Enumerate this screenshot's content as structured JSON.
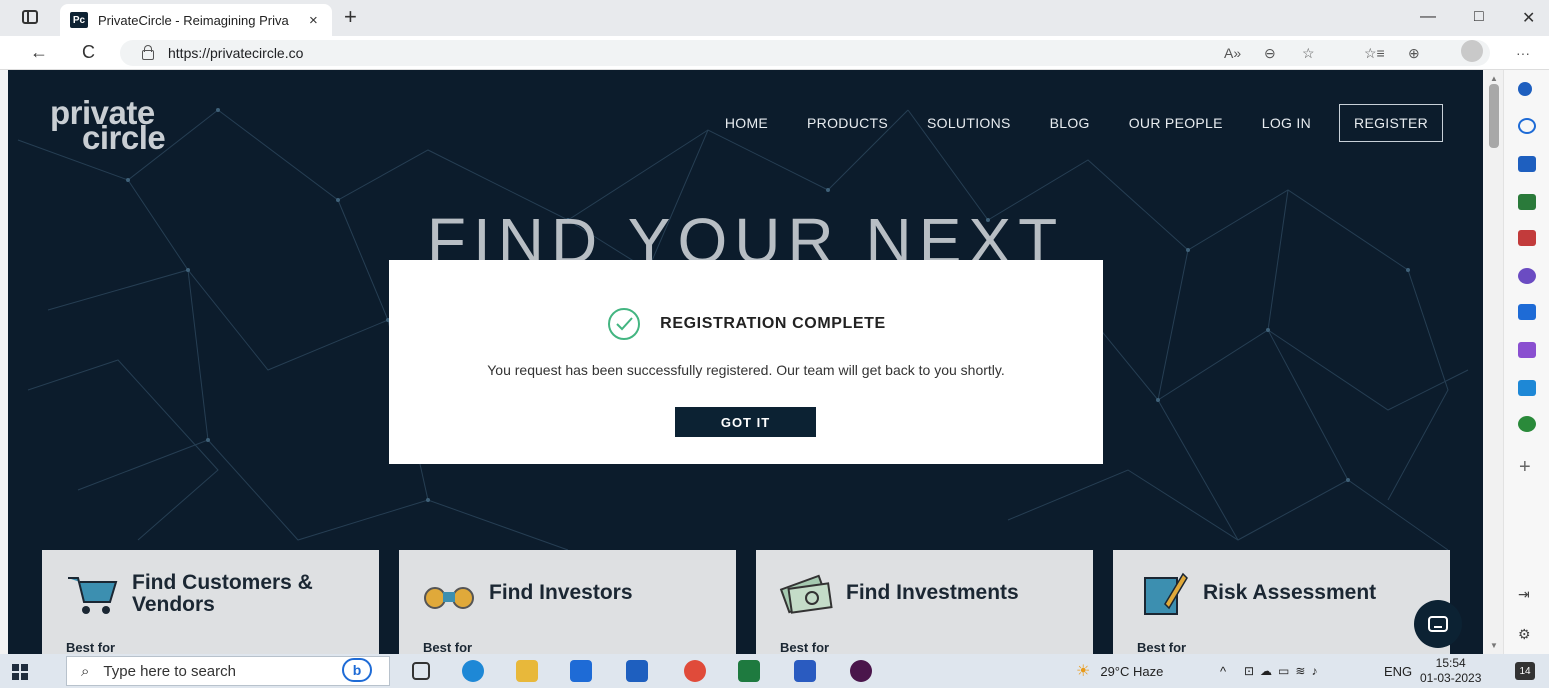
{
  "browser": {
    "tab_title": "PrivateCircle - Reimagining Priva",
    "tab_favicon": "Pc",
    "tab_close": "×",
    "new_tab": "+",
    "url": "https://privatecircle.co",
    "back": "←",
    "refresh": "C",
    "read_aloud": "A»",
    "zoom": "⊖",
    "favorites_add": "☆",
    "favorites": "☆≡",
    "collections": "⊕",
    "more": "···",
    "minimize": "—",
    "restore": "□",
    "close": "✕"
  },
  "site": {
    "logo_line1": "private",
    "logo_line2": "circle",
    "nav": {
      "home": "HOME",
      "products": "PRODUCTS",
      "solutions": "SOLUTIONS",
      "blog": "BLOG",
      "our_people": "OUR PEOPLE",
      "login": "LOG IN",
      "register": "REGISTER"
    },
    "hero_title": "FIND YOUR NEXT",
    "cards": [
      {
        "title": "Find Customers & Vendors",
        "sub": "Best for"
      },
      {
        "title": "Find Investors",
        "sub": "Best for"
      },
      {
        "title": "Find Investments",
        "sub": "Best for"
      },
      {
        "title": "Risk Assessment",
        "sub": "Best for"
      }
    ]
  },
  "modal": {
    "title": "REGISTRATION COMPLETE",
    "message": "You request has been successfully registered. Our team will get back to you shortly.",
    "button": "GOT IT"
  },
  "sidebar": {
    "add": "+"
  },
  "taskbar": {
    "search_placeholder": "Type here to search",
    "bing_label": "b",
    "weather": "29°C Haze",
    "tray_up": "^",
    "lang": "ENG",
    "time": "15:54",
    "date": "01-03-2023",
    "notifications": "14"
  },
  "colors": {
    "page_bg": "#0c1c2c",
    "accent_dark": "#0c2233",
    "check_green": "#43b581"
  }
}
